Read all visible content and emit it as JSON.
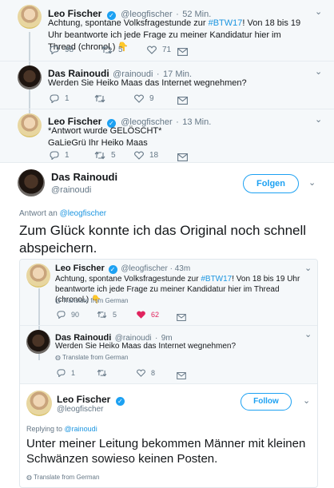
{
  "top_thread": [
    {
      "name": "Leo Fischer",
      "handle": "@leogfischer",
      "time": "52 Min.",
      "text_pre": "Achtung, spontane Volksfragestunde zur ",
      "hashtag": "#BTW17",
      "text_post": "! Von 18 bis 19 Uhr beantworte ich jede Frage zu meiner Kandidatur hier im Thread (chronol.) 👇",
      "replies": "",
      "retweets": "5",
      "likes": "71",
      "replies_count": "98"
    },
    {
      "name": "Das Rainoudi",
      "handle": "@rainoudi",
      "time": "17 Min.",
      "text": "Werden Sie Heiko Maas das Internet wegnehmen?",
      "replies_count": "1",
      "retweets": "",
      "likes": "9"
    },
    {
      "name": "Leo Fischer",
      "handle": "@leogfischer",
      "time": "13 Min.",
      "text_line1": "*Antwort wurde GELÖSCHT*",
      "text_line2": "GaLieGrü Ihr Heiko Maas",
      "replies_count": "1",
      "retweets": "5",
      "likes": "18"
    }
  ],
  "main_tweet": {
    "name": "Das Rainoudi",
    "handle": "@rainoudi",
    "follow_label": "Folgen",
    "reply_to_label": "Antwort an ",
    "reply_to_handle": "@leogfischer",
    "text": "Zum Glück konnte ich das Original noch schnell abspeichern."
  },
  "embedded": {
    "tweets": [
      {
        "name": "Leo Fischer",
        "handle": "@leogfischer",
        "time": "43m",
        "text_pre": "Achtung, spontane Volksfragestunde zur ",
        "hashtag": "#BTW17",
        "text_post": "! Von 18 bis 19 Uhr beantworte ich jede Frage zu meiner Kandidatur hier im Thread (chronol.) 👇",
        "translate": "Translate from German",
        "replies_count": "90",
        "retweets": "5",
        "likes": "62"
      },
      {
        "name": "Das Rainoudi",
        "handle": "@rainoudi",
        "time": "9m",
        "text": "Werden Sie Heiko Maas das Internet wegnehmen?",
        "translate": "Translate from German",
        "replies_count": "1",
        "retweets": "",
        "likes": "8"
      }
    ],
    "focus": {
      "name": "Leo Fischer",
      "handle": "@leogfischer",
      "follow_label": "Follow",
      "replying_label": "Replying to ",
      "replying_handle": "@rainoudi",
      "text": "Unter meiner Leitung bekommen Männer mit kleinen Schwänzen sowieso keinen Posten.",
      "translate": "Translate from German"
    }
  },
  "colors": {
    "accent": "#1da1f2",
    "like_active": "#e0245e"
  }
}
